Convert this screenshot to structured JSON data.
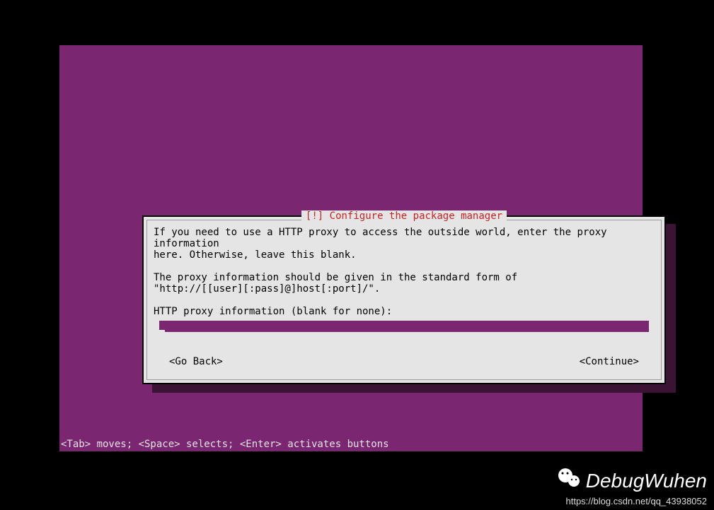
{
  "dialog": {
    "title": "[!] Configure the package manager",
    "para1": "If you need to use a HTTP proxy to access the outside world, enter the proxy information\nhere. Otherwise, leave this blank.",
    "para2": "The proxy information should be given in the standard form of\n\"http://[[user][:pass]@]host[:port]/\".",
    "prompt": "HTTP proxy information (blank for none):",
    "input_value": "",
    "go_back": "<Go Back>",
    "continue": "<Continue>"
  },
  "status_bar": "<Tab> moves; <Space> selects; <Enter> activates buttons",
  "watermark": {
    "name": "DebugWuhen",
    "url": "https://blog.csdn.net/qq_43938052"
  }
}
